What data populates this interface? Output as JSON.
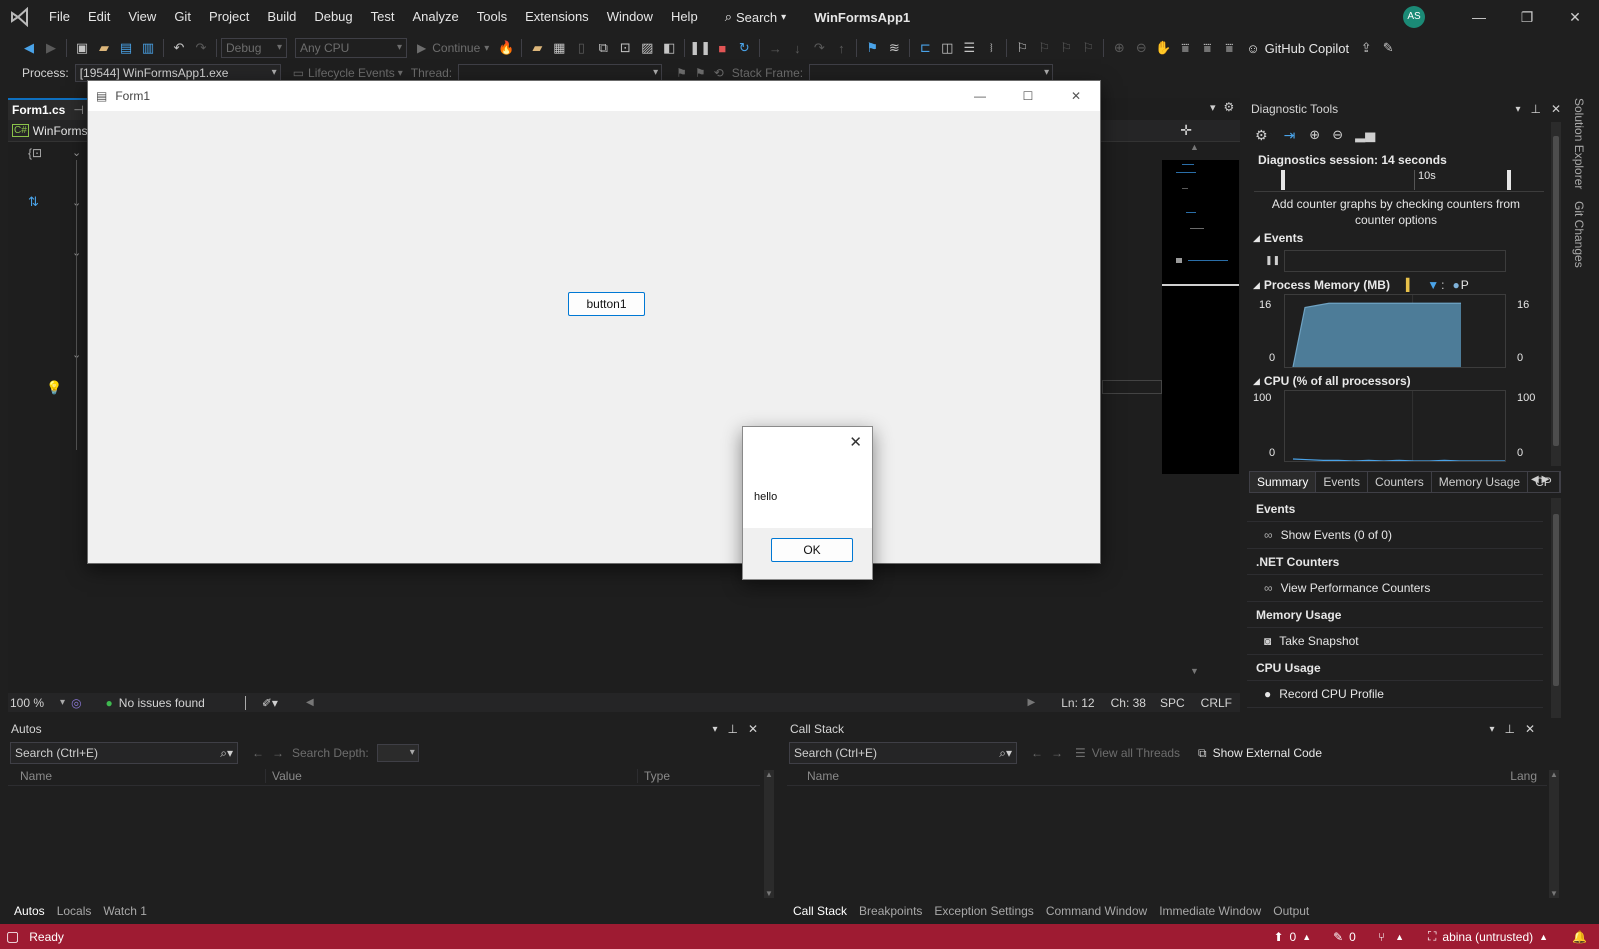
{
  "app": {
    "title": "WinFormsApp1",
    "avatar": "AS",
    "menu": [
      "File",
      "Edit",
      "View",
      "Git",
      "Project",
      "Build",
      "Debug",
      "Test",
      "Analyze",
      "Tools",
      "Extensions",
      "Window",
      "Help"
    ],
    "search_label": "Search",
    "copilot_label": "GitHub Copilot"
  },
  "toolbar": {
    "config": "Debug",
    "platform": "Any CPU",
    "continue_label": "Continue"
  },
  "process_bar": {
    "process_label": "Process:",
    "process_value": "[19544] WinFormsApp1.exe",
    "lifecycle_label": "Lifecycle Events",
    "thread_label": "Thread:",
    "stack_frame_label": "Stack Frame:"
  },
  "editor": {
    "tab_label": "Form1.cs",
    "nav_label": "WinForms",
    "zoom": "100 %",
    "issues": "No issues found",
    "line": "Ln: 12",
    "col": "Ch: 38",
    "spc": "SPC",
    "crlf": "CRLF"
  },
  "form1": {
    "title": "Form1",
    "button_label": "button1"
  },
  "messagebox": {
    "text": "hello",
    "ok_label": "OK"
  },
  "diagnostics": {
    "title": "Diagnostic Tools",
    "session": "Diagnostics session: 14 seconds",
    "timeline_tick": "10s",
    "hint": "Add counter graphs by checking counters from counter options",
    "events_label": "Events",
    "memory_label": "Process Memory (MB)",
    "memory_legend_p": "P",
    "memory_max": "16",
    "memory_min": "0",
    "cpu_label": "CPU (% of all processors)",
    "cpu_max": "100",
    "cpu_min": "0",
    "tabs": [
      "Summary",
      "Events",
      "Counters",
      "Memory Usage",
      "CP"
    ],
    "summary": {
      "events_head": "Events",
      "show_events": "Show Events (0 of 0)",
      "net_head": ".NET Counters",
      "view_counters": "View Performance Counters",
      "memory_head": "Memory Usage",
      "snapshot": "Take Snapshot",
      "cpu_head": "CPU Usage",
      "record_cpu": "Record CPU Profile"
    }
  },
  "side_tabs": [
    "Solution Explorer",
    "Git Changes"
  ],
  "autos": {
    "title": "Autos",
    "search_placeholder": "Search (Ctrl+E)",
    "search_depth": "Search Depth:",
    "columns": [
      "Name",
      "Value",
      "Type"
    ],
    "tabs": [
      "Autos",
      "Locals",
      "Watch 1"
    ]
  },
  "callstack": {
    "title": "Call Stack",
    "search_placeholder": "Search (Ctrl+E)",
    "view_all_threads": "View all Threads",
    "show_external": "Show External Code",
    "columns": [
      "Name",
      "Lang"
    ],
    "tabs": [
      "Call Stack",
      "Breakpoints",
      "Exception Settings",
      "Command Window",
      "Immediate Window",
      "Output"
    ]
  },
  "statusbar": {
    "ready": "Ready",
    "up_count": "0",
    "edit_count": "0",
    "repo": "abina (untrusted)"
  },
  "colors": {
    "accent": "#0078d4",
    "status_bar": "#9e1b32",
    "memory_fill": "#4d7c98"
  },
  "chart_data": [
    {
      "type": "area",
      "title": "Process Memory (MB)",
      "ylim": [
        0,
        16
      ],
      "x": [
        0,
        1,
        2,
        3,
        4,
        5,
        6,
        7,
        8,
        9,
        10,
        11,
        12,
        13,
        14
      ],
      "values": [
        0,
        14,
        14.5,
        15,
        15,
        15,
        15,
        15,
        15,
        15,
        15,
        15,
        15,
        15,
        15
      ]
    },
    {
      "type": "line",
      "title": "CPU (% of all processors)",
      "ylim": [
        0,
        100
      ],
      "x": [
        0,
        1,
        2,
        3,
        4,
        5,
        6,
        7,
        8,
        9,
        10,
        11,
        12,
        13,
        14
      ],
      "values": [
        3,
        2,
        1,
        1,
        0,
        1,
        0,
        1,
        0,
        0,
        1,
        0,
        0,
        0,
        0
      ]
    }
  ]
}
